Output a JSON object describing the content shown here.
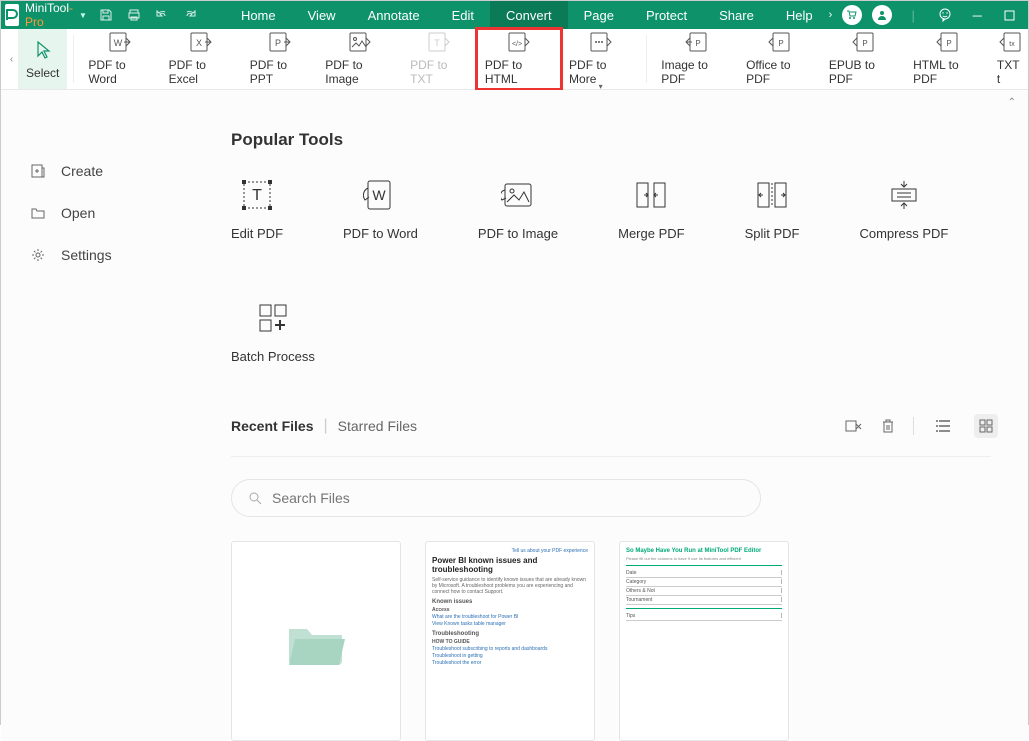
{
  "app": {
    "name": "MiniTool",
    "suffix": "-Pro"
  },
  "menus": [
    "Home",
    "View",
    "Annotate",
    "Edit",
    "Convert",
    "Page",
    "Protect",
    "Share",
    "Help"
  ],
  "active_menu": "Convert",
  "ribbon": [
    {
      "id": "select",
      "label": "Select",
      "selected": true
    },
    {
      "id": "sep"
    },
    {
      "id": "pdf-word",
      "label": "PDF to Word"
    },
    {
      "id": "pdf-excel",
      "label": "PDF to Excel"
    },
    {
      "id": "pdf-ppt",
      "label": "PDF to PPT"
    },
    {
      "id": "pdf-image",
      "label": "PDF to Image"
    },
    {
      "id": "pdf-txt",
      "label": "PDF to TXT",
      "disabled": true
    },
    {
      "id": "pdf-html",
      "label": "PDF to HTML",
      "highlighted": true
    },
    {
      "id": "pdf-more",
      "label": "PDF to More",
      "more": true
    },
    {
      "id": "sep"
    },
    {
      "id": "image-pdf",
      "label": "Image to PDF"
    },
    {
      "id": "office-pdf",
      "label": "Office to PDF"
    },
    {
      "id": "epub-pdf",
      "label": "EPUB to PDF"
    },
    {
      "id": "html-pdf",
      "label": "HTML to PDF"
    },
    {
      "id": "txt-pdf",
      "label": "TXT t"
    }
  ],
  "sidebar": [
    {
      "icon": "create",
      "label": "Create"
    },
    {
      "icon": "open",
      "label": "Open"
    },
    {
      "icon": "settings",
      "label": "Settings"
    }
  ],
  "popular_title": "Popular Tools",
  "popular": [
    {
      "id": "edit",
      "label": "Edit PDF"
    },
    {
      "id": "word",
      "label": "PDF to Word"
    },
    {
      "id": "image",
      "label": "PDF to Image"
    },
    {
      "id": "merge",
      "label": "Merge PDF"
    },
    {
      "id": "split",
      "label": "Split PDF"
    },
    {
      "id": "compress",
      "label": "Compress PDF"
    },
    {
      "id": "batch",
      "label": "Batch Process"
    }
  ],
  "files": {
    "tabs": [
      "Recent Files",
      "Starred Files"
    ],
    "active_tab": 0,
    "search_placeholder": "Search Files"
  },
  "thumb_doc1": {
    "toplink": "Tell us about your PDF experience",
    "title": "Power BI known issues and troubleshooting",
    "sub": "Self-service guidance to identify known issues that are already known by Microsoft. A troubleshoot problems you are experiencing and connect how to contact Support.",
    "sec1": "Known issues",
    "l1": "Access",
    "l2": "What are the troubleshoot for Power BI",
    "l3": "View Known tasks table manager",
    "sec2": "Troubleshooting",
    "l4": "HOW TO GUIDE",
    "l5": "Troubleshoot subscribing to reports and dashboards",
    "l6": "Troubleshoot in getting",
    "l7": "Troubleshoot the error"
  },
  "thumb_doc2": {
    "title": "So Maybe Have You Run at MiniTool PDF Editor",
    "sub": "Please fill out the columns to have 9 use its features and efficient",
    "rows": [
      "Date",
      "Category",
      "Others & Not",
      "Tournament",
      "Tips"
    ]
  }
}
